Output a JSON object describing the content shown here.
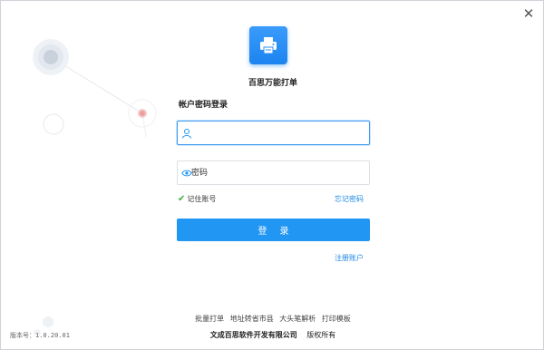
{
  "app": {
    "name": "百思万能打单",
    "logo_icon": "printer-icon",
    "accent": "#2196f3"
  },
  "login": {
    "title": "帐户密码登录",
    "username_placeholder": "",
    "password_placeholder": "密码",
    "remember_label": "记住账号",
    "remember_checked": true,
    "forgot_label": "忘记密码",
    "login_button": "登录",
    "register_label": "注册账户"
  },
  "footer": {
    "links": [
      "批量打单",
      "地址转省市县",
      "大头笔解析",
      "打印模板"
    ],
    "company": "文成百思软件开发有限公司",
    "rights": "版权所有",
    "version": "版本号：1.0.20.01"
  }
}
